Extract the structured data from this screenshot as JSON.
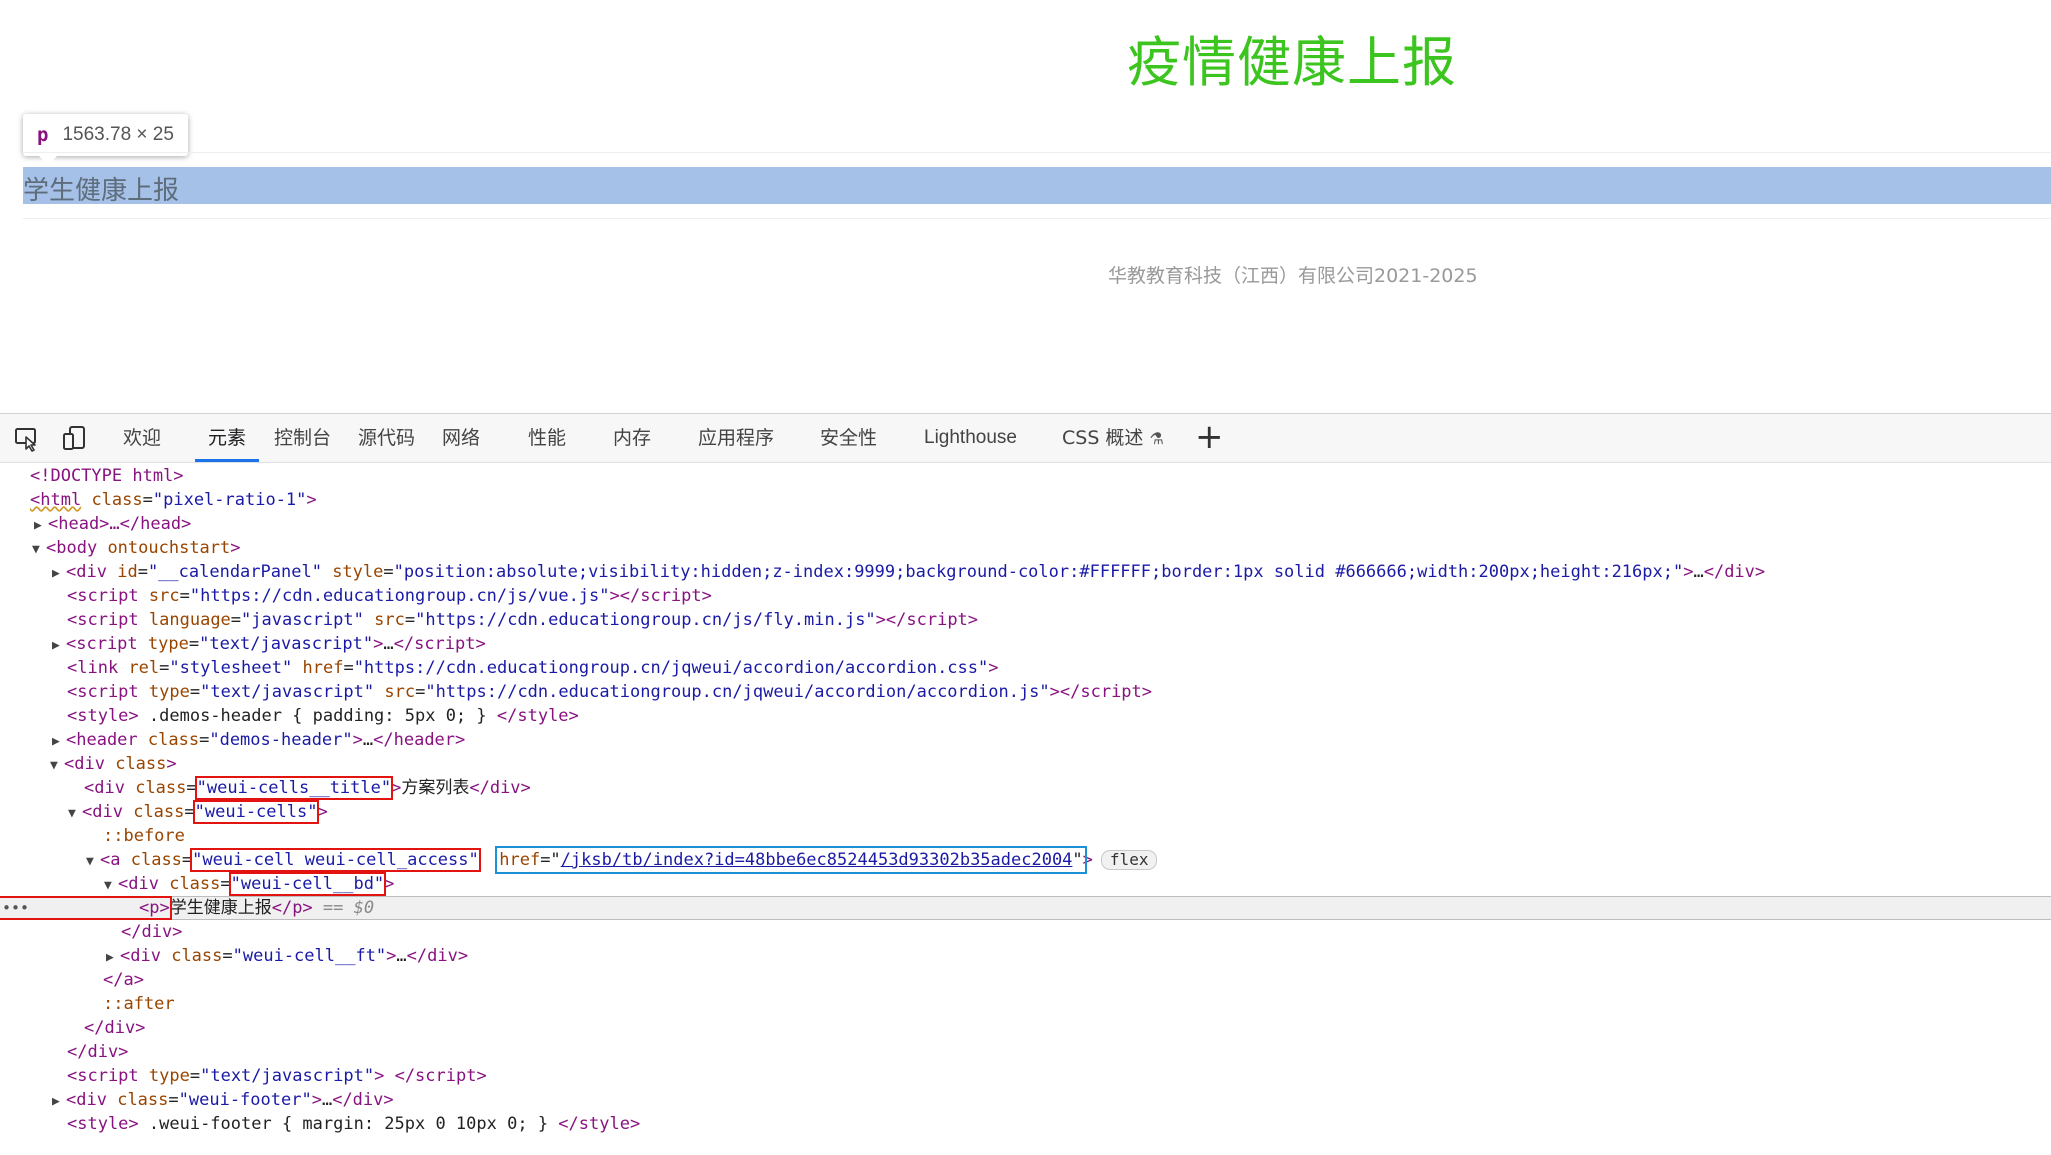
{
  "page": {
    "title": "疫情健康上报",
    "inspect_tooltip": {
      "tag": "p",
      "dimensions": "1563.78 × 25"
    },
    "highlighted_item": "学生健康上报",
    "footer": "华教教育科技（江西）有限公司2021-2025"
  },
  "devtools": {
    "tabs": [
      "欢迎",
      "元素",
      "控制台",
      "源代码",
      "网络",
      "性能",
      "内存",
      "应用程序",
      "安全性",
      "Lighthouse",
      "CSS 概述"
    ],
    "active_tab": "元素",
    "add_tab": "+",
    "tree": {
      "doctype": "<!DOCTYPE html>",
      "html_open": "<html",
      "html_class_attr": "class",
      "html_class_val": "\"pixel-ratio-1\"",
      "head": "<head>…</head>",
      "body_tag": "<body",
      "body_attr": "ontouchstart",
      "calendar_div_id": "\"__calendarPanel\"",
      "calendar_div_style": "\"position:absolute;visibility:hidden;z-index:9999;background-color:#FFFFFF;border:1px solid #666666;width:200px;height:216px;\"",
      "script1_src": "\"https://cdn.educationgroup.cn/js/vue.js\"",
      "script2_lang": "\"javascript\"",
      "script2_src": "\"https://cdn.educationgroup.cn/js/fly.min.js\"",
      "script3_type": "\"text/javascript\"",
      "link_rel": "\"stylesheet\"",
      "link_href": "\"https://cdn.educationgroup.cn/jqweui/accordion/accordion.css\"",
      "script4_type": "\"text/javascript\"",
      "script4_src": "\"https://cdn.educationgroup.cn/jqweui/accordion/accordion.js\"",
      "style1": " .demos-header { padding: 5px 0; } ",
      "header_class": "\"demos-header\"",
      "div_class_empty": "class",
      "cells_title_class": "\"weui-cells__title\"",
      "cells_title_text": "方案列表",
      "cells_class": "\"weui-cells\"",
      "before": "::before",
      "a_class": "\"weui-cell weui-cell_access\"",
      "a_href_attr": "href",
      "a_href": "/jksb/tb/index?id=48bbe6ec8524453d93302b35adec2004",
      "flex_badge": "flex",
      "bd_class": "\"weui-cell__bd\"",
      "p_text": "学生健康上报",
      "p_marker": "== $0",
      "ft_class": "\"weui-cell__ft\"",
      "after": "::after",
      "script5_type": "\"text/javascript\"",
      "footer_div_class": "\"weui-footer\"",
      "style2": " .weui-footer { margin: 25px 0 10px 0; } ",
      "ellipsis": "…"
    }
  }
}
